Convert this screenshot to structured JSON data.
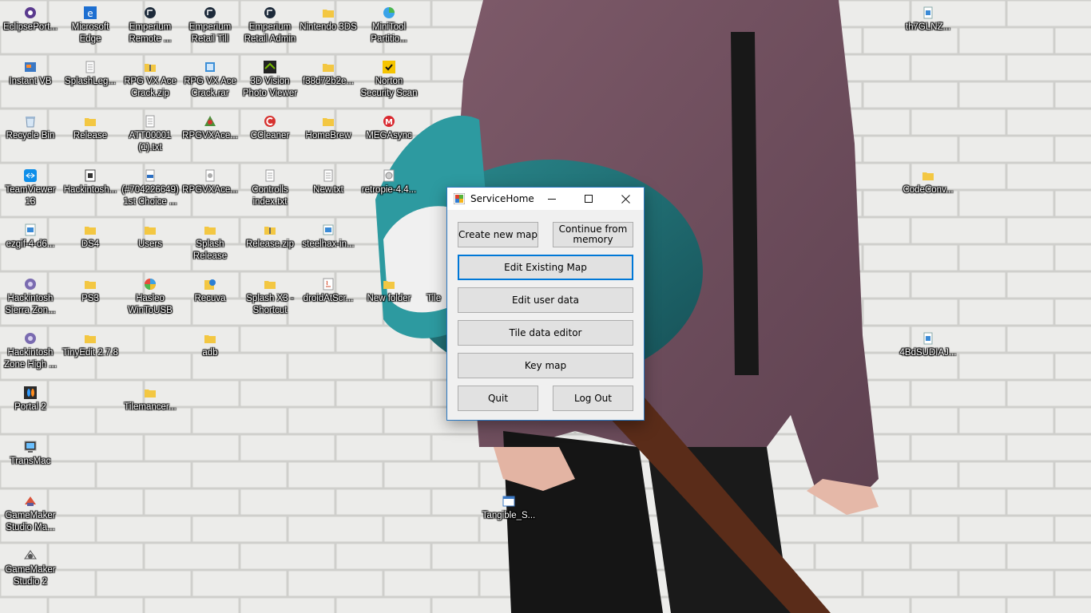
{
  "desktop": {
    "icons": [
      {
        "label": "EclipsePort...",
        "icon": "eclipse-icon"
      },
      {
        "label": "Microsoft Edge",
        "icon": "edge-icon"
      },
      {
        "label": "Emperium Remote ...",
        "icon": "emperium-icon"
      },
      {
        "label": "Emperium Retail Till",
        "icon": "emperium-icon"
      },
      {
        "label": "Emperium Retail Admin",
        "icon": "emperium-icon"
      },
      {
        "label": "Nintendo 3DS",
        "icon": "folder-icon"
      },
      {
        "label": "MiniTool Partitio...",
        "icon": "minitool-icon"
      },
      {
        "label": "th7GLNZ...",
        "icon": "image-file-icon"
      },
      {
        "label": "Instant VB",
        "icon": "app-icon"
      },
      {
        "label": "SplashLeg...",
        "icon": "text-file-icon"
      },
      {
        "label": "RPG VX Ace Crack.zip",
        "icon": "zip-folder-icon"
      },
      {
        "label": "RPG VX Ace Crack.rar",
        "icon": "archive-icon"
      },
      {
        "label": "3D Vision Photo Viewer",
        "icon": "nvidia-icon"
      },
      {
        "label": "f38d72b2e...",
        "icon": "folder-icon"
      },
      {
        "label": "Norton Security Scan",
        "icon": "norton-icon"
      },
      {
        "label": "Recycle Bin",
        "icon": "recycle-bin-icon"
      },
      {
        "label": "Release",
        "icon": "folder-icon"
      },
      {
        "label": "ATT00001 (1).txt",
        "icon": "text-file-icon"
      },
      {
        "label": "RPGVXAce...",
        "icon": "rpg-icon"
      },
      {
        "label": "CCleaner",
        "icon": "ccleaner-icon"
      },
      {
        "label": "HomeBrew",
        "icon": "folder-icon"
      },
      {
        "label": "MEGAsync",
        "icon": "mega-icon"
      },
      {
        "label": "TeamViewer 13",
        "icon": "teamviewer-icon"
      },
      {
        "label": "Hackintosh...",
        "icon": "app-icon"
      },
      {
        "label": "(#704226649) 1st Choice ...",
        "icon": "pdf-file-icon"
      },
      {
        "label": "RPGVXAce...",
        "icon": "text-file-icon"
      },
      {
        "label": "Controlls index.txt",
        "icon": "text-file-icon"
      },
      {
        "label": "New.txt",
        "icon": "text-file-icon"
      },
      {
        "label": "retropie-4.4...",
        "icon": "disc-image-icon"
      },
      {
        "label": "CodeConv...",
        "icon": "folder-icon"
      },
      {
        "label": "ezgif-4-d6...",
        "icon": "image-file-icon"
      },
      {
        "label": "DS4",
        "icon": "folder-icon"
      },
      {
        "label": "Users",
        "icon": "folder-icon"
      },
      {
        "label": "Splash Release",
        "icon": "folder-icon"
      },
      {
        "label": "Release.zip",
        "icon": "zip-folder-icon"
      },
      {
        "label": "steelhax-in...",
        "icon": "image-file-icon"
      },
      {
        "label": "Hackintosh Sierra Zon...",
        "icon": "hackintosh-icon"
      },
      {
        "label": "PS3",
        "icon": "folder-icon"
      },
      {
        "label": "Hasleo WinToUSB",
        "icon": "wintousb-icon"
      },
      {
        "label": "Recuva",
        "icon": "recuva-icon"
      },
      {
        "label": "Splash X3 - Shortcut",
        "icon": "folder-icon"
      },
      {
        "label": "droidAtScr...",
        "icon": "java-icon"
      },
      {
        "label": "New folder",
        "icon": "folder-icon"
      },
      {
        "label": "Tile",
        "icon": "folder-icon"
      },
      {
        "label": "Hackintosh Zone High ...",
        "icon": "hackintosh-icon"
      },
      {
        "label": "TinyEdit 2.7.8",
        "icon": "folder-icon"
      },
      {
        "label": "adb",
        "icon": "folder-icon"
      },
      {
        "label": "4BdSUDIAJ...",
        "icon": "image-file-icon"
      },
      {
        "label": "Portal 2",
        "icon": "portal-icon"
      },
      {
        "label": "Tilemancer...",
        "icon": "folder-icon"
      },
      {
        "label": "TransMac",
        "icon": "transmac-icon"
      },
      {
        "label": "Tangible_S...",
        "icon": "window-file-icon"
      },
      {
        "label": "GameMaker Studio Ma...",
        "icon": "gamemaker-icon"
      },
      {
        "label": "GameMaker Studio 2",
        "icon": "gamemaker-icon"
      }
    ]
  },
  "window": {
    "title": "ServiceHome",
    "app_icon": "windows-form-icon",
    "controls": {
      "minimize": "minimize-icon",
      "maximize": "maximize-icon",
      "close": "close-icon"
    },
    "buttons": {
      "create_new_map": "Create new map",
      "continue_from_memory": "Continue from memory",
      "edit_existing_map": "Edit Existing Map",
      "edit_user_data": "Edit user data",
      "tile_data_editor": "Tile data editor",
      "key_map": "Key map",
      "quit": "Quit",
      "log_out": "Log Out"
    },
    "focused_button": "edit_existing_map",
    "accent_color": "#0078d7"
  }
}
